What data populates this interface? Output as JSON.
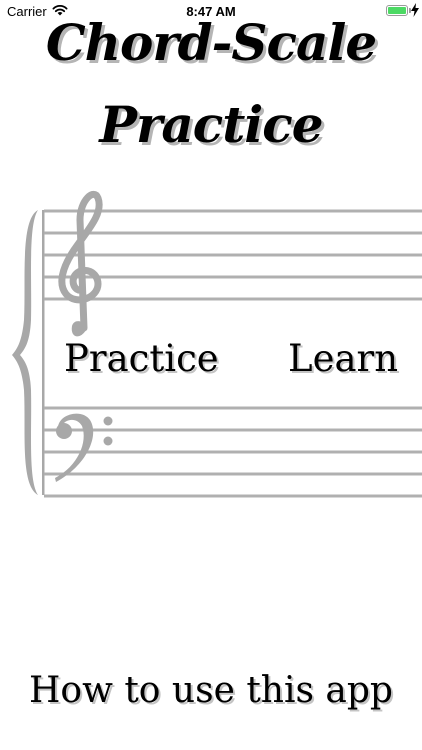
{
  "status_bar": {
    "carrier": "Carrier",
    "time": "8:47 AM",
    "battery_level": 1.0
  },
  "title": {
    "line1": "Chord-Scale",
    "line2": "Practice"
  },
  "menu": {
    "practice_label": "Practice",
    "learn_label": "Learn",
    "how_to_label": "How to use this app"
  },
  "icons": {
    "brace": "grand-staff-brace-icon",
    "treble_clef": "treble-clef-icon",
    "bass_clef": "bass-clef-icon"
  },
  "colors": {
    "staff_gray": "#a8a8a8",
    "text": "#000000",
    "text_shadow": "#c4c4c4",
    "battery_green": "#4cd964"
  }
}
